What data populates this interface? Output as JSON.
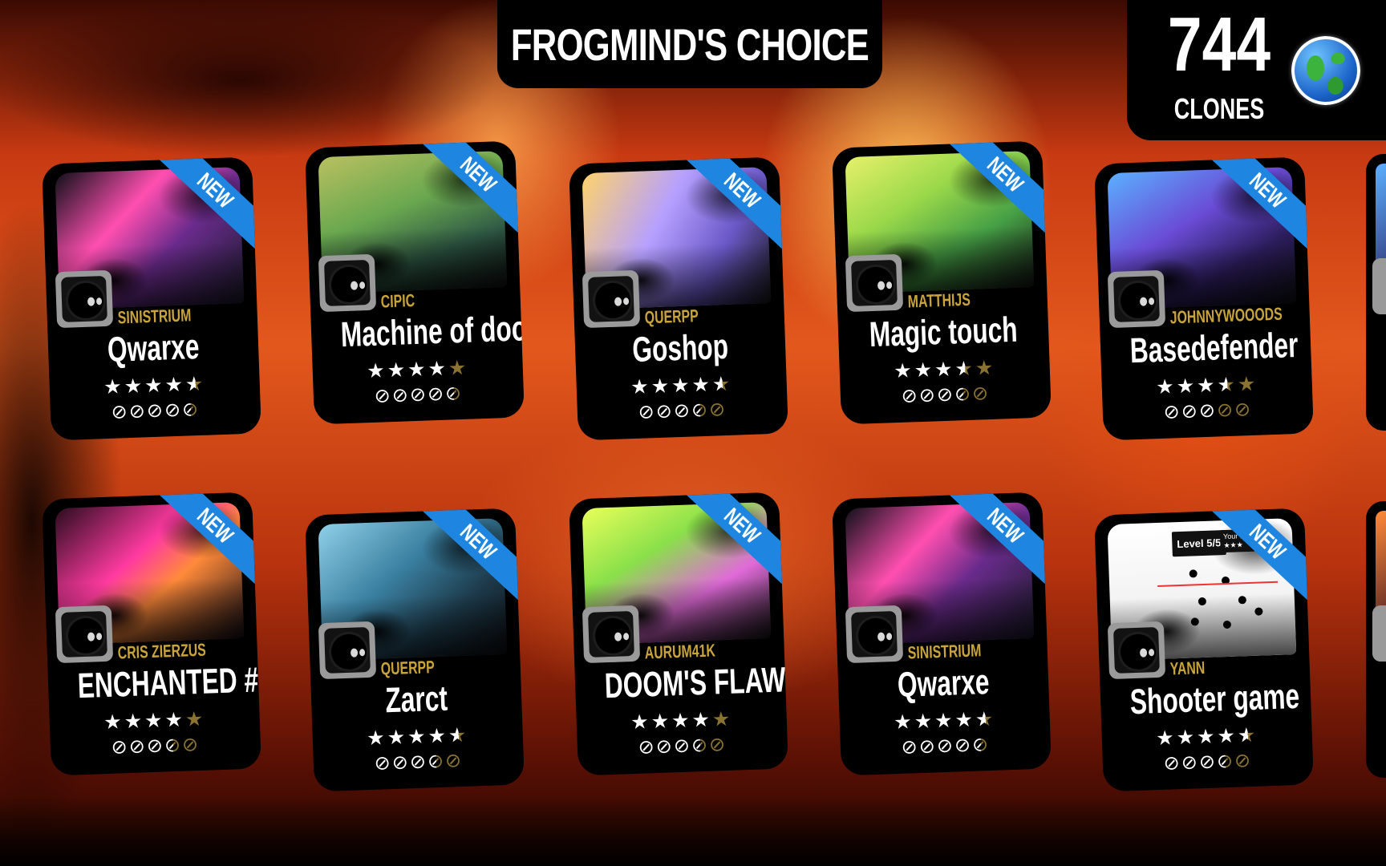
{
  "header": {
    "title": "FROGMIND'S CHOICE",
    "clones_count": "744",
    "clones_label": "CLONES"
  },
  "icons": {
    "globe": "globe-icon",
    "new_badge": "new-ribbon",
    "star": "star-icon",
    "difficulty": "skull-icon",
    "avatar": "clone-avatar-icon"
  },
  "colors": {
    "ribbon": "#1e86e0",
    "author": "#c9a43a",
    "rating_off": "#8a7230"
  },
  "cards": [
    {
      "new_label": "NEW",
      "author": "SINISTRIUM",
      "name": "Qwarxe",
      "rating": 4.5,
      "difficulty": 4.5,
      "thumb": "linear-gradient(135deg,#101018 0%,#ff4fb0 35%,#6a2b8c 60%,#1a1a2a 100%)"
    },
    {
      "new_label": "NEW",
      "author": "CIPIC",
      "name": "Machine of doom",
      "rating": 4,
      "difficulty": 4.5,
      "thumb": "linear-gradient(160deg,#b9c060 0%,#6aa84f 40%,#2f5a46 70%,#101010 100%)"
    },
    {
      "new_label": "NEW",
      "author": "QUERPP",
      "name": "Goshop",
      "rating": 4.5,
      "difficulty": 3.5,
      "thumb": "linear-gradient(120deg,#ffd36a 0%,#b6a0ff 40%,#6b59c8 70%,#161616 100%)"
    },
    {
      "new_label": "NEW",
      "author": "MATTHIJS",
      "name": "Magic touch",
      "rating": 3.5,
      "difficulty": 3.5,
      "thumb": "linear-gradient(150deg,#e6f06a 0%,#9bd94a 35%,#46a046 65%,#141414 100%)"
    },
    {
      "new_label": "NEW",
      "author": "JOHNNYWOOODS",
      "name": "Basedefender",
      "rating": 3.5,
      "difficulty": 3,
      "thumb": "linear-gradient(150deg,#5bb0ff 0%,#6a4cd6 40%,#2b1c5a 70%,#0f0f14 100%)"
    },
    {
      "new_label": "NEW",
      "author": "CRIS ZIERZUS",
      "name": "ENCHANTED #HW",
      "rating": 4,
      "difficulty": 3.5,
      "thumb": "linear-gradient(140deg,#2a0c1e 0%,#ff3aa0 40%,#ff8a3a 60%,#140c14 100%)"
    },
    {
      "new_label": "NEW",
      "author": "QUERPP",
      "name": "Zarct",
      "rating": 4.5,
      "difficulty": 3.5,
      "thumb": "linear-gradient(140deg,#8fd0e8 0%,#3a7fa0 40%,#1d3a4a 70%,#0c0c10 100%)"
    },
    {
      "new_label": "NEW",
      "author": "AURUM41K",
      "name": "DOOM'S FLAW",
      "rating": 4,
      "difficulty": 3.5,
      "thumb": "linear-gradient(150deg,#e8ff5a 0%,#8ae04a 35%,#e06ad8 65%,#141414 100%)"
    },
    {
      "new_label": "NEW",
      "author": "SINISTRIUM",
      "name": "Qwarxe",
      "rating": 4.5,
      "difficulty": 4.5,
      "thumb": "linear-gradient(135deg,#101018 0%,#ff4fb0 35%,#6a2b8c 60%,#1a1a2a 100%)"
    },
    {
      "new_label": "NEW",
      "author": "YANN",
      "name": "Shooter game",
      "rating": 4.5,
      "difficulty": 3.5,
      "thumb": "linear-gradient(180deg,#ffffff 0%,#f2f2f2 60%,#e8e8e8 100%)",
      "overlay_level": "Level 5/5",
      "overlay_lives": "Your Li...",
      "overlay_lives_stars": "★★★"
    }
  ]
}
